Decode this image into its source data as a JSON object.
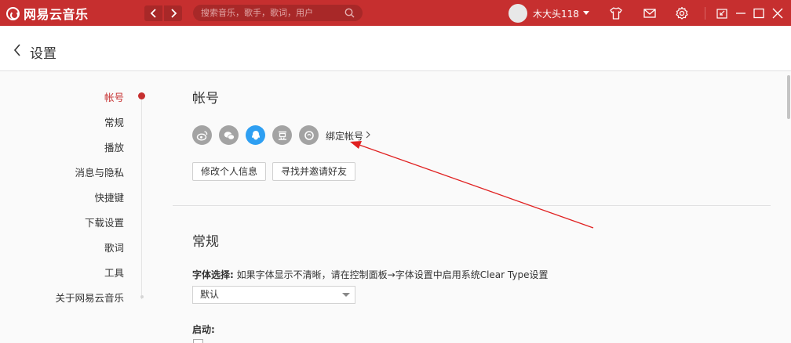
{
  "app": {
    "name": "网易云音乐",
    "brand_color": "#c62f2f",
    "logo_icon": "netease-music-logo-icon"
  },
  "titlebar": {
    "back_icon": "chevron-left-icon",
    "forward_icon": "chevron-right-icon",
    "search_placeholder": "搜索音乐，歌手，歌词，用户",
    "username": "木大头118",
    "icons": [
      "skin-tshirt-icon",
      "mail-icon",
      "gear-icon",
      "mini-mode-icon",
      "minimize-icon",
      "maximize-icon",
      "close-icon"
    ]
  },
  "header": {
    "title": "设置"
  },
  "sidebar": {
    "items": [
      {
        "label": "帐号",
        "active": true
      },
      {
        "label": "常规",
        "active": false
      },
      {
        "label": "播放",
        "active": false
      },
      {
        "label": "消息与隐私",
        "active": false
      },
      {
        "label": "快捷键",
        "active": false
      },
      {
        "label": "下载设置",
        "active": false
      },
      {
        "label": "歌词",
        "active": false
      },
      {
        "label": "工具",
        "active": false
      },
      {
        "label": "关于网易云音乐",
        "active": false
      }
    ]
  },
  "account": {
    "title": "帐号",
    "social_icons": [
      "weibo-icon",
      "wechat-icon",
      "qq-icon",
      "douban-icon",
      "yixin-icon"
    ],
    "bind_label": "绑定帐号",
    "edit_profile_button": "修改个人信息",
    "find_friends_button": "寻找并邀请好友"
  },
  "general": {
    "title": "常规",
    "font_label": "字体选择:",
    "font_hint": "如果字体显示不清晰，请在控制面板→字体设置中启用系统Clear Type设置",
    "font_value": "默认",
    "startup_label": "启动:"
  },
  "annotation_color": "#e02020"
}
